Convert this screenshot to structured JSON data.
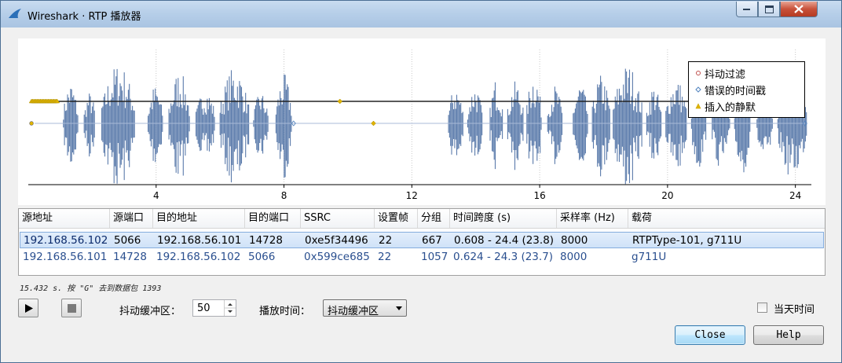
{
  "window": {
    "title": "Wireshark · RTP 播放器"
  },
  "plot": {
    "legend": [
      {
        "label": "抖动过滤",
        "marker": "circle",
        "color": "#c0504d"
      },
      {
        "label": "错误的时间戳",
        "marker": "diamond",
        "color": "#4f81bd"
      },
      {
        "label": "插入的静默",
        "marker": "triangle",
        "color": "#c9a400"
      }
    ],
    "x_ticks": [
      "4",
      "8",
      "12",
      "16",
      "20",
      "24"
    ],
    "waveform_color": "#5b7bab"
  },
  "chart_data": {
    "type": "line",
    "xlim": [
      0,
      24.5
    ],
    "x_ticks": [
      4,
      8,
      12,
      16,
      20,
      24
    ],
    "grid": "vertical dotted at ticks",
    "legend_placement": "top-right",
    "series": [
      {
        "name": "",
        "stream": 1,
        "time_span_s": [
          0.608,
          24.4
        ],
        "baseline": "dark"
      },
      {
        "name": "",
        "stream": 2,
        "time_span_s": [
          0.624,
          24.3
        ],
        "baseline": "light"
      }
    ]
  },
  "table": {
    "headers": [
      "源地址",
      "源端口",
      "目的地址",
      "目的端口",
      "SSRC",
      "设置帧",
      "分组",
      "时间跨度 (s)",
      "采样率 (Hz)",
      "载荷"
    ],
    "rows": [
      [
        "192.168.56.102",
        "5066",
        "192.168.56.101",
        "14728",
        "0xe5f34496",
        "22",
        "667",
        "0.608 - 24.4 (23.8)",
        "8000",
        "RTPType-101, g711U"
      ],
      [
        "192.168.56.101",
        "14728",
        "192.168.56.102",
        "5066",
        "0x599ce685",
        "22",
        "1057",
        "0.624 - 24.3 (23.7)",
        "8000",
        "g711U"
      ]
    ]
  },
  "status": {
    "text": "15.432 s. 按 \"G\" 去到数据包 1393"
  },
  "controls": {
    "jitter_label": "抖动缓冲区：",
    "jitter_value": "50",
    "playback_label": "播放时间：",
    "playback_value": "抖动缓冲区",
    "today_label": "当天时间",
    "today_checked": false,
    "close_label": "Close",
    "help_label": "Help"
  }
}
